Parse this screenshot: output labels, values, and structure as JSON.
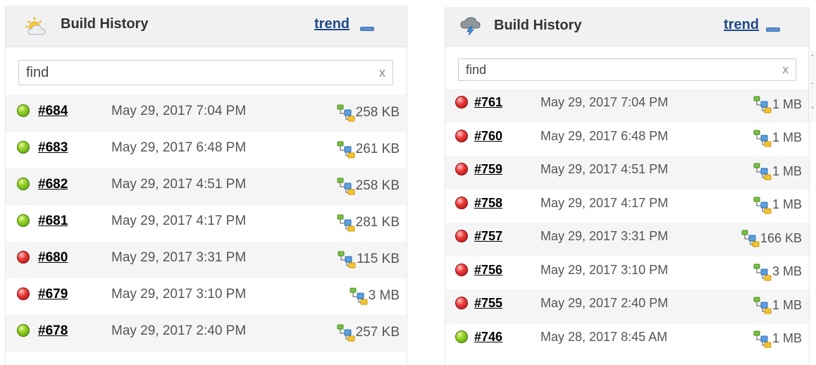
{
  "panels": [
    {
      "title": "Build History",
      "trend_label": "trend",
      "header_icon": "sun-cloud-weather-icon",
      "search": {
        "placeholder": "find",
        "clear_label": "x"
      },
      "builds": [
        {
          "number": "#684",
          "status": "success",
          "date": "May 29, 2017 7:04 PM",
          "size": "258 KB"
        },
        {
          "number": "#683",
          "status": "success",
          "date": "May 29, 2017 6:48 PM",
          "size": "261 KB"
        },
        {
          "number": "#682",
          "status": "success",
          "date": "May 29, 2017 4:51 PM",
          "size": "258 KB"
        },
        {
          "number": "#681",
          "status": "success",
          "date": "May 29, 2017 4:17 PM",
          "size": "281 KB"
        },
        {
          "number": "#680",
          "status": "failure",
          "date": "May 29, 2017 3:31 PM",
          "size": "115 KB"
        },
        {
          "number": "#679",
          "status": "failure",
          "date": "May 29, 2017 3:10 PM",
          "size": "3 MB"
        },
        {
          "number": "#678",
          "status": "success",
          "date": "May 29, 2017 2:40 PM",
          "size": "257 KB"
        }
      ]
    },
    {
      "title": "Build History",
      "trend_label": "trend",
      "header_icon": "storm-cloud-weather-icon",
      "search": {
        "placeholder": "find",
        "clear_label": "x"
      },
      "builds": [
        {
          "number": "#761",
          "status": "failure",
          "date": "May 29, 2017 7:04 PM",
          "size": "1 MB"
        },
        {
          "number": "#760",
          "status": "failure",
          "date": "May 29, 2017 6:48 PM",
          "size": "1 MB"
        },
        {
          "number": "#759",
          "status": "failure",
          "date": "May 29, 2017 4:51 PM",
          "size": "1 MB"
        },
        {
          "number": "#758",
          "status": "failure",
          "date": "May 29, 2017 4:17 PM",
          "size": "1 MB"
        },
        {
          "number": "#757",
          "status": "failure",
          "date": "May 29, 2017 3:31 PM",
          "size": "166 KB"
        },
        {
          "number": "#756",
          "status": "failure",
          "date": "May 29, 2017 3:10 PM",
          "size": "3 MB"
        },
        {
          "number": "#755",
          "status": "failure",
          "date": "May 29, 2017 2:40 PM",
          "size": "1 MB"
        },
        {
          "number": "#746",
          "status": "success",
          "date": "May 28, 2017 8:45 AM",
          "size": "1 MB"
        }
      ]
    }
  ],
  "colors": {
    "success": "#7cc11a",
    "failure": "#e53b3b",
    "link": "#204a87",
    "header_bg": "#f1f1f1",
    "row_shade": "#f5f5f5"
  }
}
